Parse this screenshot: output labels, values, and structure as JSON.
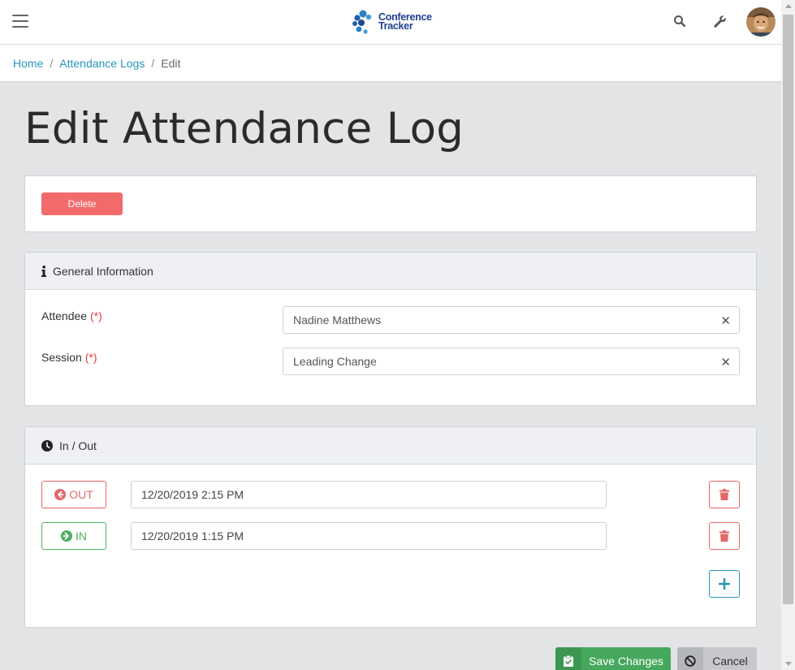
{
  "header": {
    "logo_line1": "Conference",
    "logo_line2": "Tracker",
    "icons": [
      "menu-icon",
      "search-icon",
      "wrench-icon",
      "avatar"
    ]
  },
  "breadcrumb": {
    "items": [
      "Home",
      "Attendance Logs"
    ],
    "current": "Edit",
    "separator": "/"
  },
  "page": {
    "title": "Edit Attendance Log",
    "delete_label": "Delete"
  },
  "general_info": {
    "header": "General Information",
    "required_marker": "(*)",
    "attendee_label": "Attendee",
    "attendee_value": "Nadine Matthews",
    "session_label": "Session",
    "session_value": "Leading Change"
  },
  "in_out": {
    "header": "In / Out",
    "entries": [
      {
        "type": "OUT",
        "datetime": "12/20/2019 2:15 PM"
      },
      {
        "type": "IN",
        "datetime": "12/20/2019 1:15 PM"
      }
    ]
  },
  "actions": {
    "save_label": "Save Changes",
    "cancel_label": "Cancel"
  },
  "colors": {
    "link": "#2596b8",
    "danger": "#f26b6b",
    "success": "#45a85c",
    "required": "#e23a3a"
  }
}
